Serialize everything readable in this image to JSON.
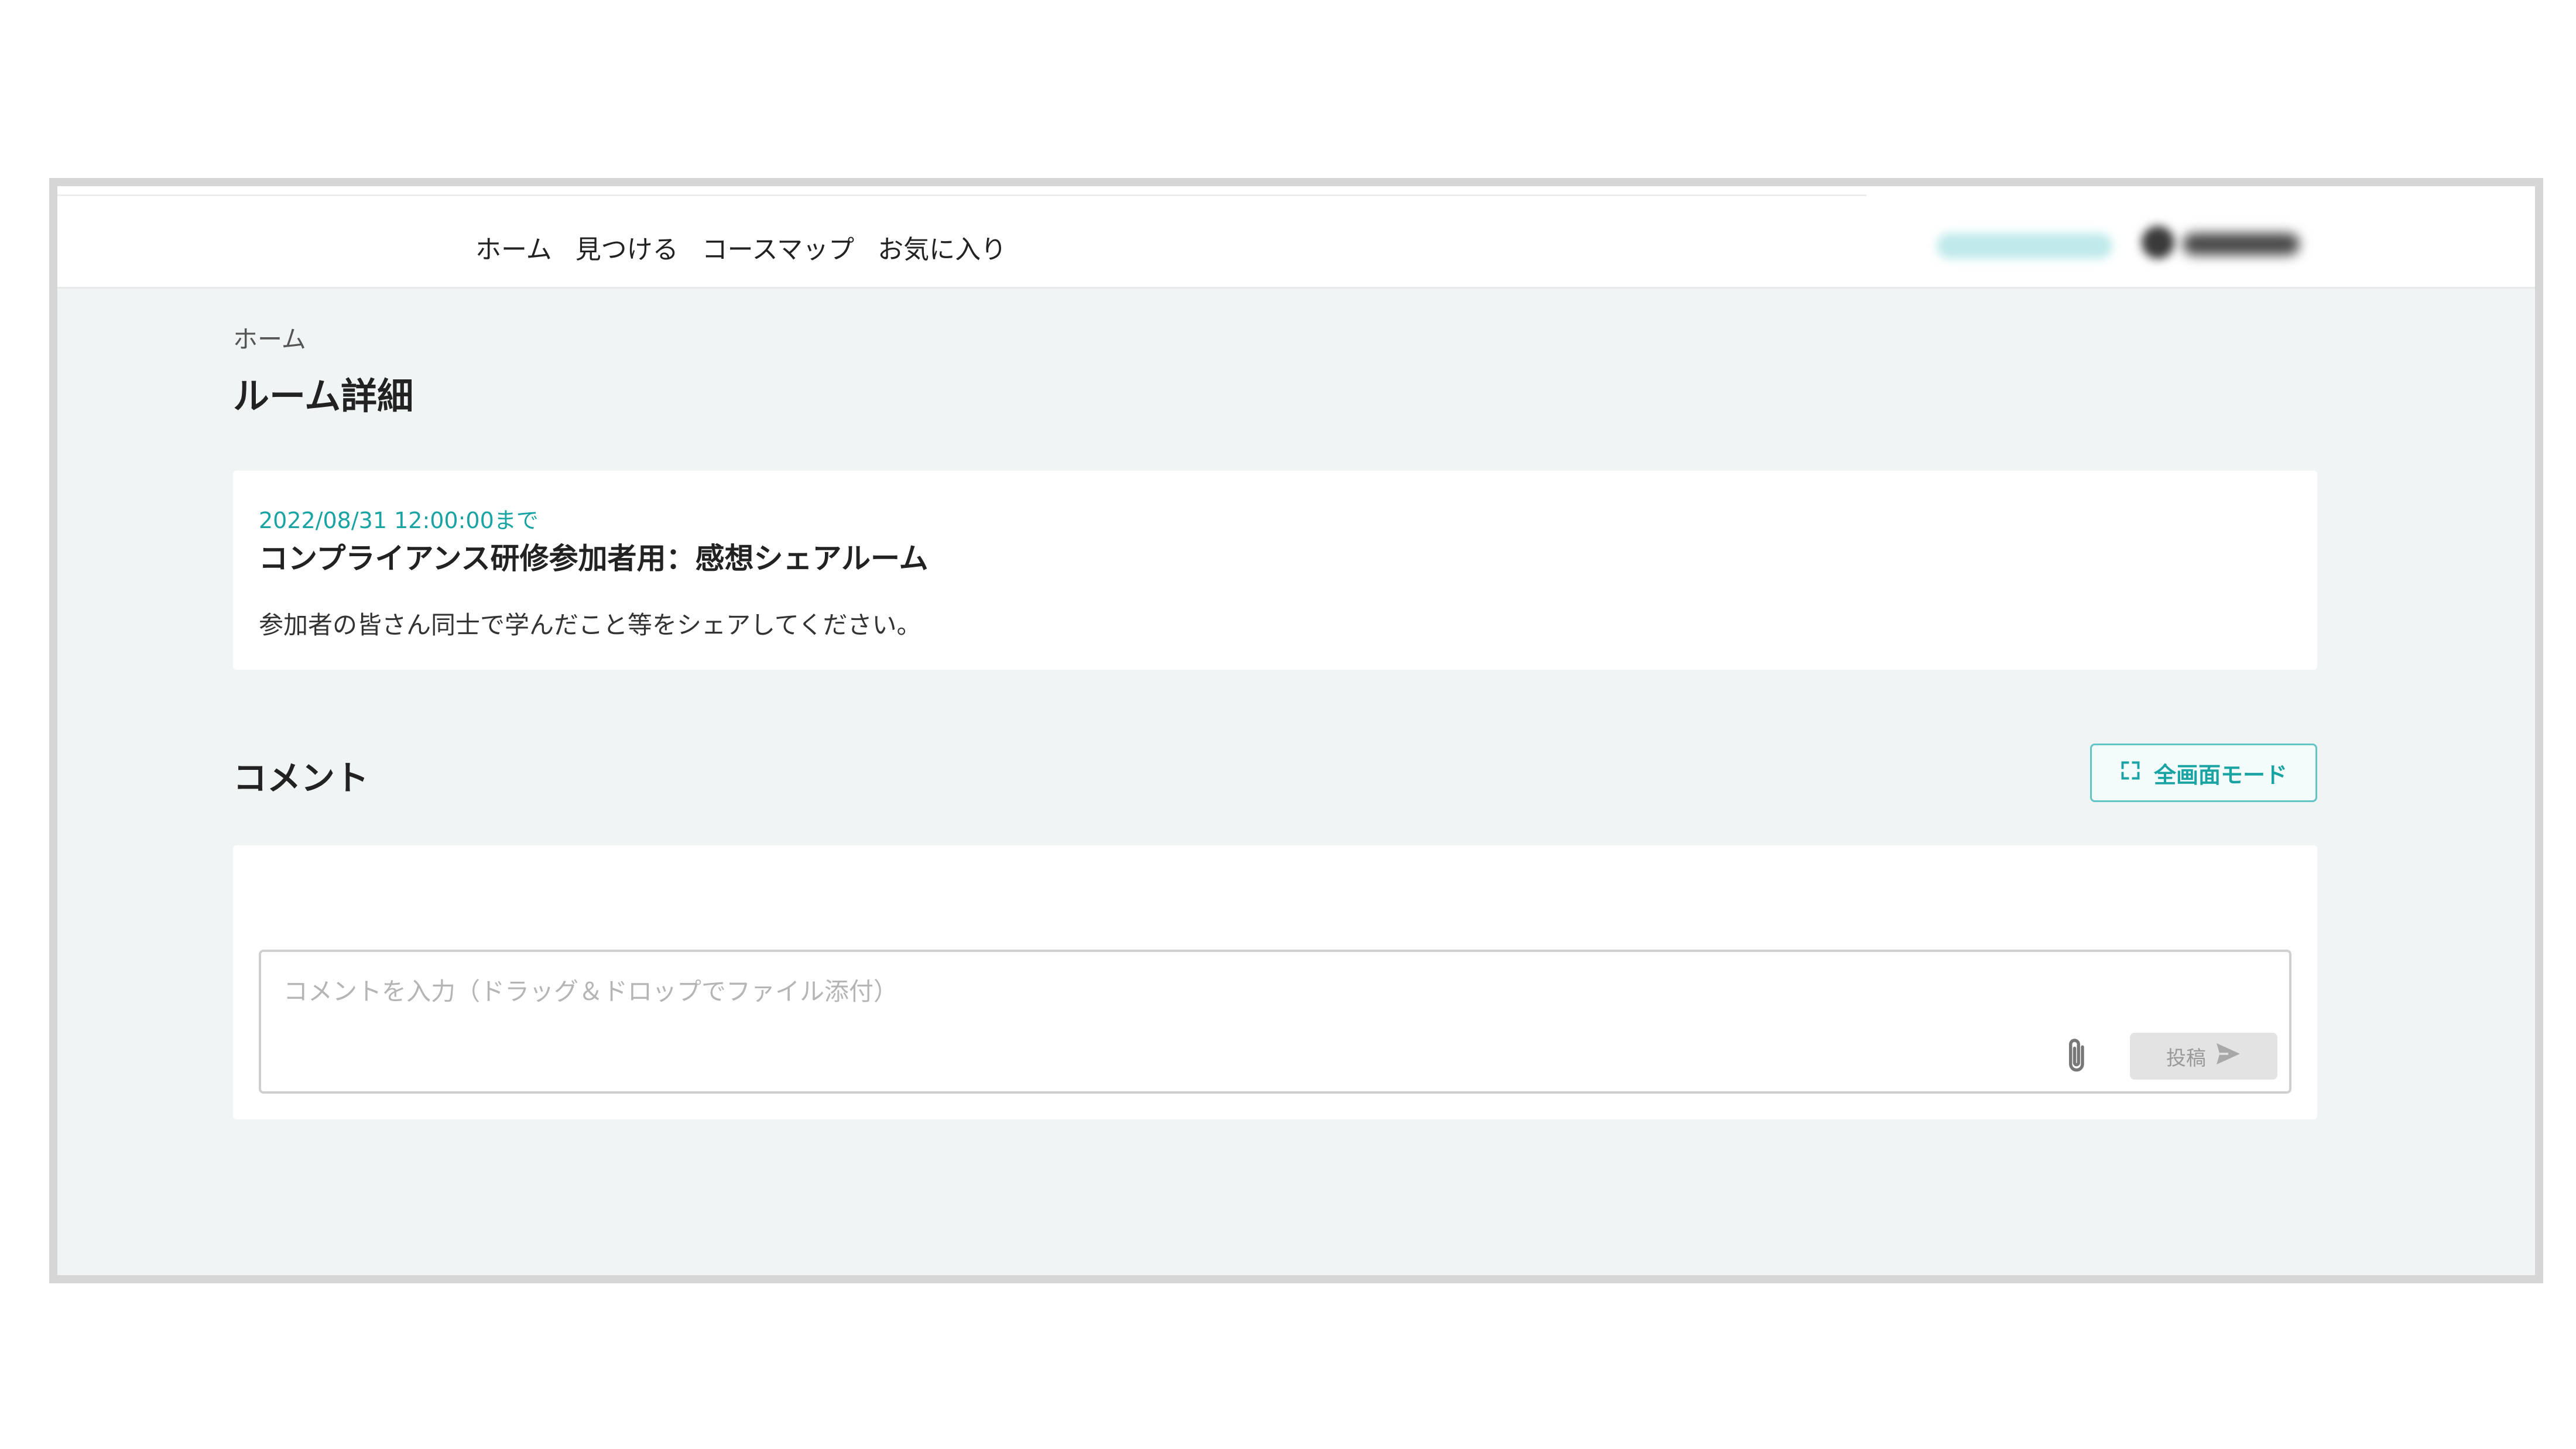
{
  "nav": {
    "items": [
      {
        "label": "ホーム"
      },
      {
        "label": "見つける"
      },
      {
        "label": "コースマップ"
      },
      {
        "label": "お気に入り"
      }
    ]
  },
  "breadcrumb": "ホーム",
  "page_title": "ルーム詳細",
  "room": {
    "deadline": "2022/08/31 12:00:00まで",
    "title": "コンプライアンス研修参加者用：感想シェアルーム",
    "description": "参加者の皆さん同士で学んだこと等をシェアしてください。"
  },
  "comments": {
    "heading": "コメント",
    "fullscreen_label": "全画面モード",
    "input_placeholder": "コメントを入力（ドラッグ＆ドロップでファイル添付）",
    "input_value": "",
    "post_label": "投稿"
  },
  "icons": {
    "fullscreen": "fullscreen-icon",
    "attach": "paperclip-icon",
    "send": "send-icon"
  },
  "colors": {
    "accent": "#1aa3a3",
    "page_background": "#f1f4f4",
    "card_background": "#ffffff"
  }
}
